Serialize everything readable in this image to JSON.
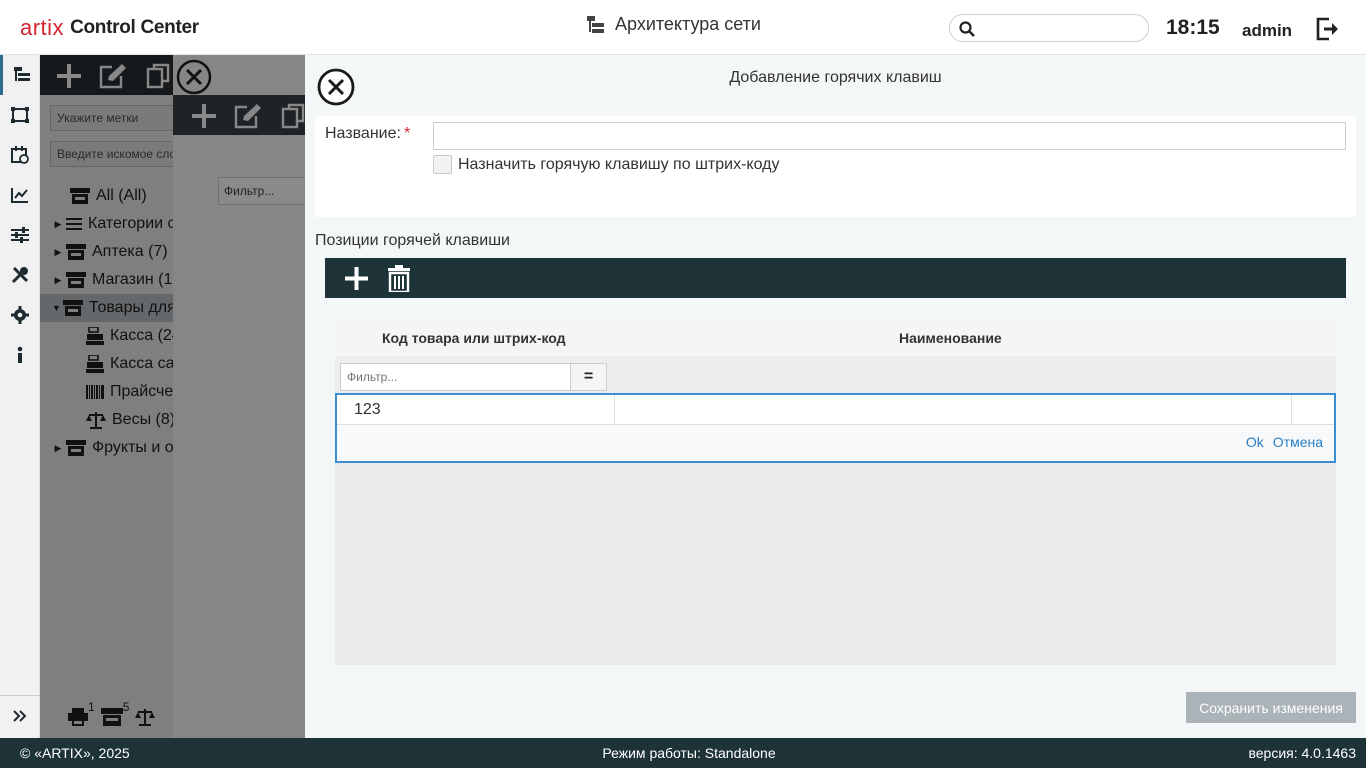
{
  "header": {
    "logo_brand": "artix",
    "logo_app": "Control Center",
    "title": "Архитектура сети",
    "search_placeholder": "",
    "time": "18:15",
    "user": "admin"
  },
  "rail": {
    "items": [
      "tree-icon",
      "frame-icon",
      "calendar-icon",
      "chart-icon",
      "sliders-icon",
      "tools-icon",
      "gear-icon",
      "info-icon"
    ],
    "expand": "expand-icon"
  },
  "tree_panel": {
    "tags_placeholder": "Укажите метки",
    "search_placeholder": "Введите искомое сло",
    "items": [
      {
        "label": "All (All)",
        "icon": "store-icon",
        "caret": ""
      },
      {
        "label": "Категории с",
        "icon": "list-icon",
        "caret": "▶"
      },
      {
        "label": "Аптека (7)",
        "icon": "store-icon",
        "caret": "▶"
      },
      {
        "label": "Магазин (1",
        "icon": "store-icon",
        "caret": "▶"
      },
      {
        "label": "Товары для",
        "icon": "store-icon",
        "caret": "▼"
      },
      {
        "label": "Касса (24",
        "icon": "cash-register-icon",
        "caret": ""
      },
      {
        "label": "Касса са",
        "icon": "cash-register-icon",
        "caret": ""
      },
      {
        "label": "Прайсче",
        "icon": "barcode-icon",
        "caret": ""
      },
      {
        "label": "Весы (8)",
        "icon": "scales-icon",
        "caret": ""
      },
      {
        "label": "Фрукты и о",
        "icon": "store-icon",
        "caret": "▶"
      }
    ],
    "bottom_counts": [
      "1",
      "5"
    ]
  },
  "mid_panel": {
    "filter_placeholder": "Фильтр..."
  },
  "dialog": {
    "title": "Добавление горячих клавиш",
    "name_label": "Название:",
    "required_mark": "*",
    "name_value": "",
    "barcode_checkbox_label": "Назначить горячую клавишу по штрих-коду",
    "barcode_checked": false,
    "positions_title": "Позиции горячей клавиши",
    "grid": {
      "columns": [
        "Код товара или штрих-код",
        "Наименование"
      ],
      "filter_placeholder": "Фильтр...",
      "filter_operator": "=",
      "edit_row": {
        "code": "123",
        "name": ""
      },
      "ok_label": "Ok",
      "cancel_label": "Отмена"
    },
    "save_label": "Сохранить изменения"
  },
  "footer": {
    "copyright": "© «ARTIX», 2025",
    "mode": "Режим работы: Standalone",
    "version": "версия: 4.0.1463"
  },
  "colors": {
    "brand_red": "#d6262f",
    "dark_toolbar": "#1e3337",
    "link_blue": "#2a7fc1",
    "focus_blue": "#3c8ed3"
  }
}
